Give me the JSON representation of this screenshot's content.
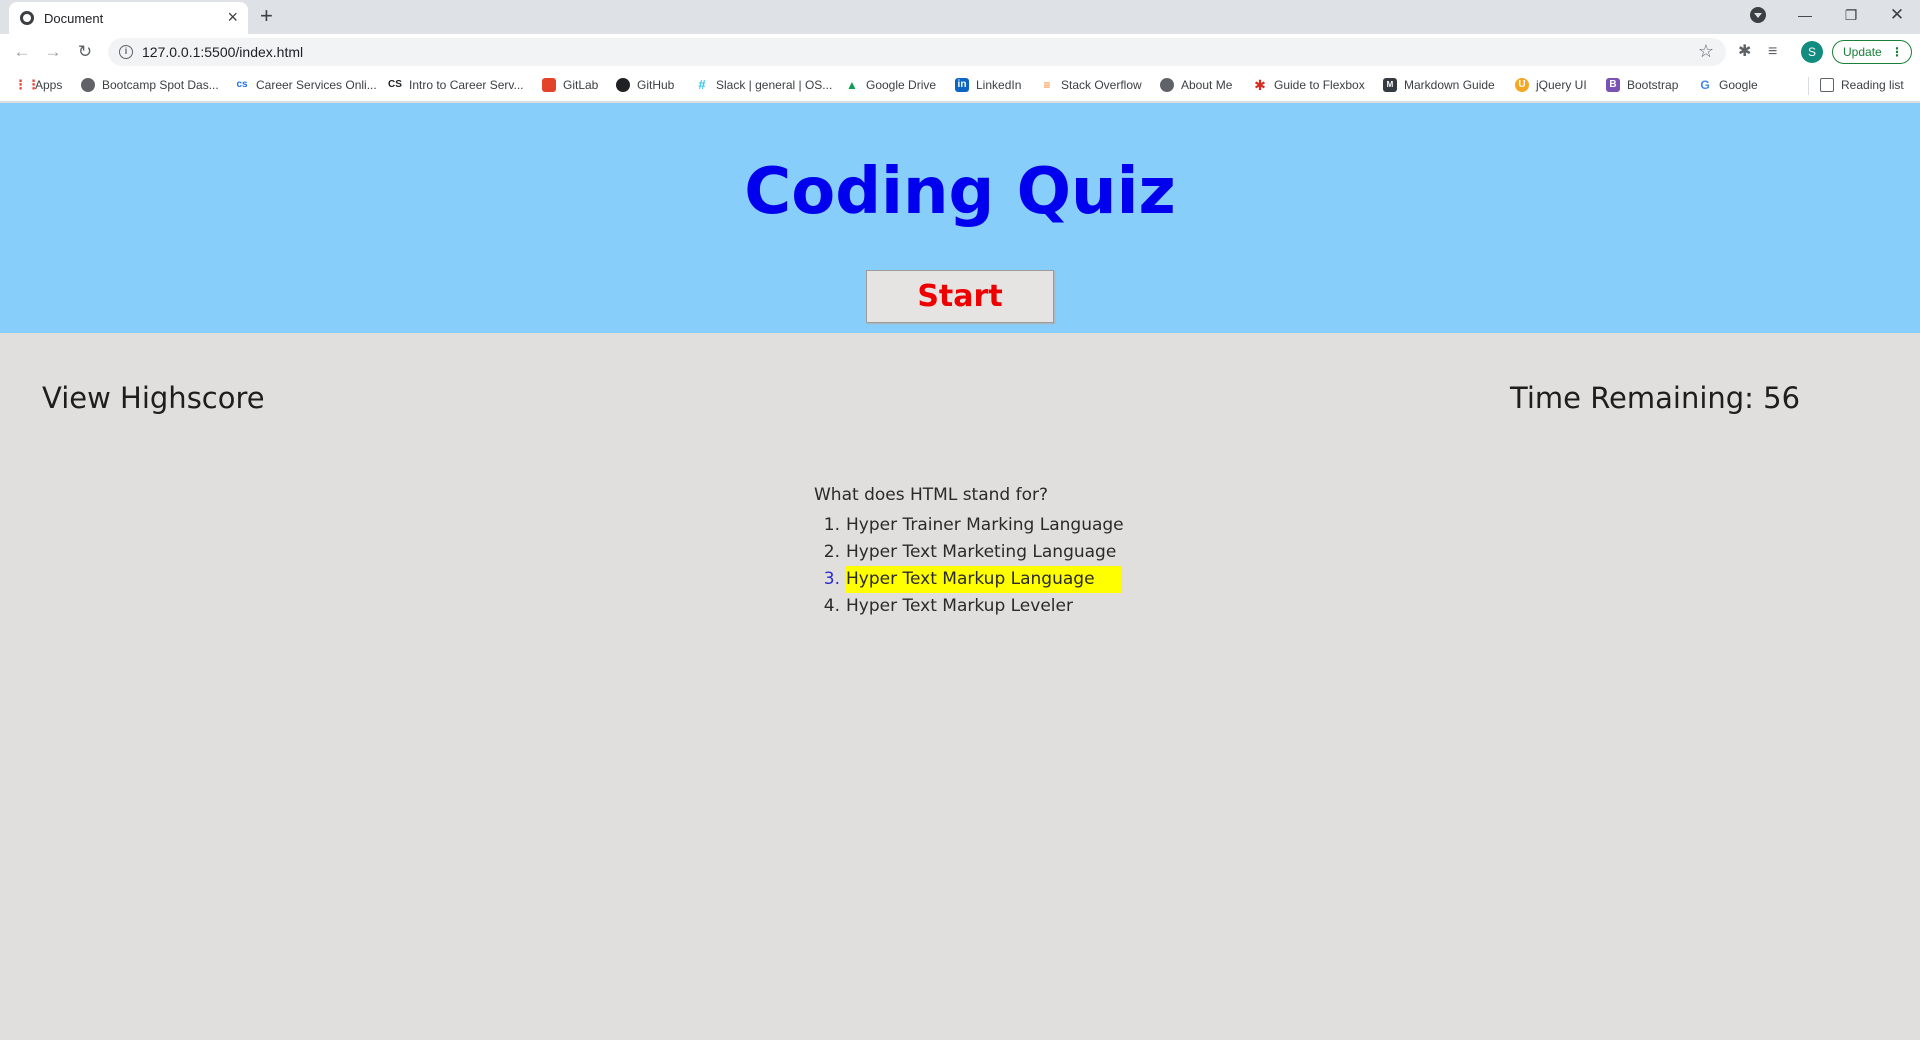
{
  "browser": {
    "tab_title": "Document",
    "url": "127.0.0.1:5500/index.html",
    "profile_initial": "S",
    "update_label": "Update",
    "bookmarks": [
      {
        "label": "Apps",
        "icon": "apps-grid-icon",
        "color": "#ea4335"
      },
      {
        "label": "Bootcamp Spot Das...",
        "icon": "globe-icon",
        "color": "#5f6368"
      },
      {
        "label": "Career Services Onli...",
        "icon": "cs-icon",
        "color": "#1a73e8"
      },
      {
        "label": "Intro to Career Serv...",
        "icon": "cs-icon",
        "color": "#202124"
      },
      {
        "label": "GitLab",
        "icon": "gitlab-icon",
        "color": "#e24329"
      },
      {
        "label": "GitHub",
        "icon": "github-icon",
        "color": "#202124"
      },
      {
        "label": "Slack | general | OS...",
        "icon": "slack-icon",
        "color": "#36c5f0"
      },
      {
        "label": "Google Drive",
        "icon": "google-drive-icon",
        "color": "#0f9d58"
      },
      {
        "label": "LinkedIn",
        "icon": "linkedin-icon",
        "color": "#0a66c2"
      },
      {
        "label": "Stack Overflow",
        "icon": "stack-overflow-icon",
        "color": "#f48024"
      },
      {
        "label": "About Me",
        "icon": "globe-icon",
        "color": "#5f6368"
      },
      {
        "label": "Guide to Flexbox",
        "icon": "css-tricks-icon",
        "color": "#d62d20"
      },
      {
        "label": "Markdown Guide",
        "icon": "markdown-icon",
        "color": "#343a40"
      },
      {
        "label": "jQuery UI",
        "icon": "jquery-icon",
        "color": "#f5a623"
      },
      {
        "label": "Bootstrap",
        "icon": "bootstrap-icon",
        "color": "#7952b3"
      },
      {
        "label": "Google",
        "icon": "google-icon",
        "color": "#4285f4"
      }
    ],
    "reading_list": "Reading list"
  },
  "page": {
    "title": "Coding Quiz",
    "start_label": "Start",
    "highscore_label": "View Highscore",
    "timer_text": "Time Remaining: 56",
    "question": "What does HTML stand for?",
    "choices": [
      {
        "num": "1.",
        "text": "Hyper Trainer Marking Language"
      },
      {
        "num": "2.",
        "text": "Hyper Text Marketing Language"
      },
      {
        "num": "3.",
        "text": "Hyper Text Markup Language"
      },
      {
        "num": "4.",
        "text": "Hyper Text Markup Leveler"
      }
    ],
    "highlighted_choice_index": 2,
    "colors": {
      "header_bg": "#87cefa",
      "title": "#0000ee",
      "start_text": "#ee0000",
      "highlight": "#ffff00",
      "page_bg": "#e0dfdd"
    }
  }
}
